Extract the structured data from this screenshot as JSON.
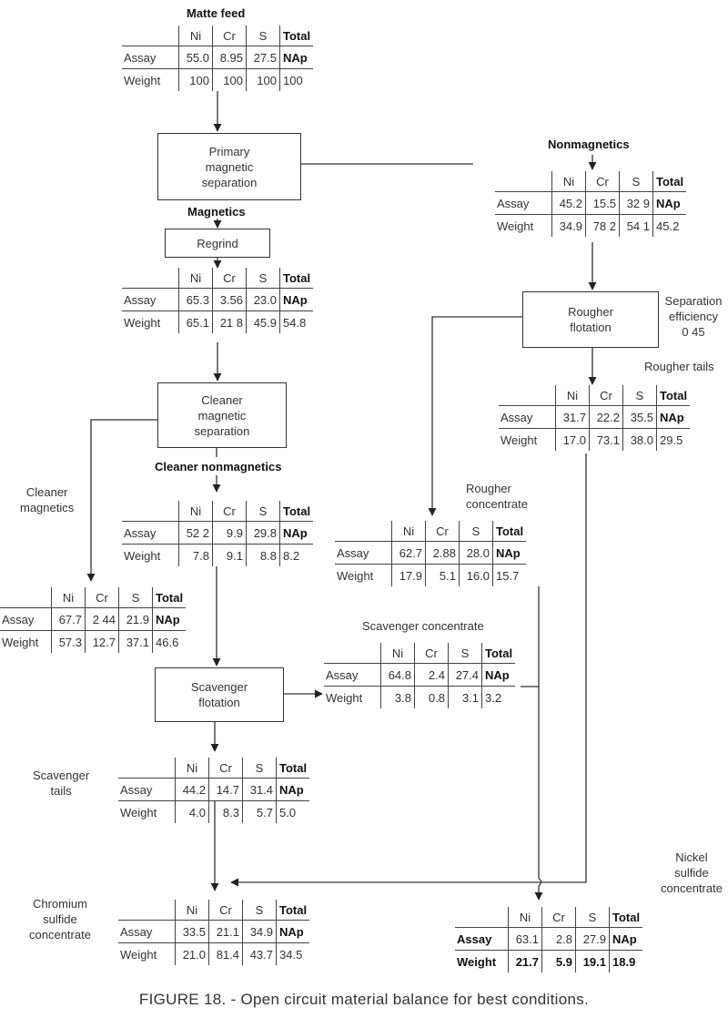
{
  "columns": [
    "Ni",
    "Cr",
    "S",
    "Total"
  ],
  "row_labels": {
    "assay": "Assay",
    "weight": "Weight"
  },
  "streams": {
    "matte_feed": {
      "label": "Matte feed",
      "assay": [
        "55.0",
        "8.95",
        "27.5",
        "NAp"
      ],
      "weight": [
        "100",
        "100",
        "100",
        "100"
      ]
    },
    "nonmagnetics": {
      "label": "Nonmagnetics",
      "assay": [
        "45.2",
        "15.5",
        "32 9",
        "NAp"
      ],
      "weight": [
        "34.9",
        "78 2",
        "54 1",
        "45.2"
      ]
    },
    "magnetics": {
      "label": "Magnetics",
      "assay": [
        "65.3",
        "3.56",
        "23.0",
        "NAp"
      ],
      "weight": [
        "65.1",
        "21 8",
        "45.9",
        "54.8"
      ]
    },
    "rougher_tails": {
      "label": "Rougher tails",
      "assay": [
        "31.7",
        "22.2",
        "35.5",
        "NAp"
      ],
      "weight": [
        "17.0",
        "73.1",
        "38.0",
        "29.5"
      ]
    },
    "cleaner_nonmagnetics": {
      "label": "Cleaner nonmagnetics",
      "assay": [
        "52 2",
        "9.9",
        "29.8",
        "NAp"
      ],
      "weight": [
        "7.8",
        "9.1",
        "8.8",
        "8.2"
      ]
    },
    "rougher_concentrate": {
      "label": "Rougher concentrate",
      "assay": [
        "62.7",
        "2.88",
        "28.0",
        "NAp"
      ],
      "weight": [
        "17.9",
        "5.1",
        "16.0",
        "15.7"
      ]
    },
    "cleaner_magnetics": {
      "label": "Cleaner magnetics",
      "assay": [
        "67.7",
        "2 44",
        "21.9",
        "NAp"
      ],
      "weight": [
        "57.3",
        "12.7",
        "37.1",
        "46.6"
      ]
    },
    "scavenger_concentrate": {
      "label": "Scavenger concentrate",
      "assay": [
        "64.8",
        "2.4",
        "27.4",
        "NAp"
      ],
      "weight": [
        "3.8",
        "0.8",
        "3.1",
        "3.2"
      ]
    },
    "scavenger_tails": {
      "label": "Scavenger tails",
      "assay": [
        "44.2",
        "14.7",
        "31.4",
        "NAp"
      ],
      "weight": [
        "4.0",
        "8.3",
        "5.7",
        "5.0"
      ]
    },
    "chromium_sulfide_concentrate": {
      "label": "Chromium sulfide concentrate",
      "assay": [
        "33.5",
        "21.1",
        "34.9",
        "NAp"
      ],
      "weight": [
        "21.0",
        "81.4",
        "43.7",
        "34.5"
      ]
    },
    "nickel_sulfide_concentrate": {
      "label": "Nickel sulfide concentrate",
      "assay": [
        "63.1",
        "2.8",
        "27.9",
        "NAp"
      ],
      "weight": [
        "21.7",
        "5.9",
        "19.1",
        "18.9"
      ]
    }
  },
  "labels": {
    "matte_feed": "Matte feed",
    "nonmagnetics": "Nonmagnetics",
    "magnetics": "Magnetics",
    "rougher_tails": "Rougher tails",
    "cleaner_nonmagnetics": "Cleaner nonmagnetics",
    "rougher_concentrate_1": "Rougher",
    "rougher_concentrate_2": "concentrate",
    "cleaner_magnetics_1": "Cleaner",
    "cleaner_magnetics_2": "magnetics",
    "scavenger_concentrate": "Scavenger concentrate",
    "scavenger_tails_1": "Scavenger",
    "scavenger_tails_2": "tails",
    "chromium_1": "Chromium",
    "chromium_2": "sulfide",
    "chromium_3": "concentrate",
    "nickel_1": "Nickel",
    "nickel_2": "sulfide",
    "nickel_3": "concentrate",
    "sep_eff_1": "Separation",
    "sep_eff_2": "efficiency",
    "sep_eff_value": "0 45"
  },
  "processes": {
    "primary": [
      "Primary",
      "magnetic",
      "separation"
    ],
    "regrind": "Regrind",
    "rougher": [
      "Rougher",
      "flotation"
    ],
    "cleaner": [
      "Cleaner",
      "magnetic",
      "separation"
    ],
    "scavenger": [
      "Scavenger",
      "flotation"
    ]
  },
  "caption": "FIGURE 18. - Open circuit material balance for best conditions."
}
